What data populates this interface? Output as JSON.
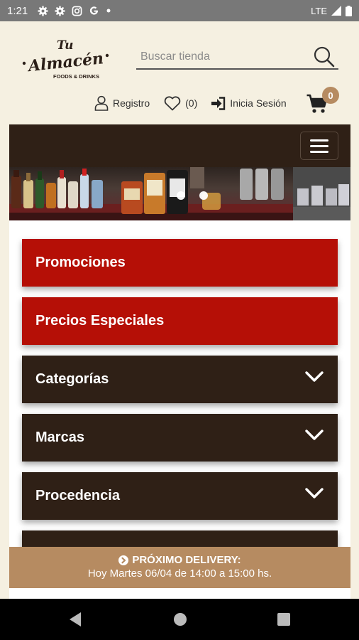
{
  "status_bar": {
    "time": "1:21",
    "network": "LTE",
    "icons": [
      "gear-icon",
      "gear-icon",
      "instagram-icon",
      "google-icon",
      "dot-icon",
      "wifi-icon",
      "signal-icon",
      "battery-icon"
    ]
  },
  "header": {
    "logo": {
      "line1": "Tu",
      "line2": "Almacén",
      "tagline": "FOODS & DRINKS"
    },
    "search": {
      "placeholder": "Buscar tienda",
      "value": ""
    },
    "register_label": "Registro",
    "wishlist_count": "(0)",
    "login_label": "Inicia Sesión",
    "cart_count": "0"
  },
  "menu": {
    "items": [
      {
        "label": "Promociones",
        "style": "red",
        "expandable": false
      },
      {
        "label": "Precios Especiales",
        "style": "red",
        "expandable": false
      },
      {
        "label": "Categorías",
        "style": "brown",
        "expandable": true
      },
      {
        "label": "Marcas",
        "style": "brown",
        "expandable": true
      },
      {
        "label": "Procedencia",
        "style": "brown",
        "expandable": true
      }
    ]
  },
  "delivery": {
    "title": "PRÓXIMO DELIVERY:",
    "detail": "Hoy Martes 06/04 de 14:00 a 15:00 hs."
  },
  "colors": {
    "background": "#f5f0e1",
    "red": "#b50f06",
    "brown": "#2f2016",
    "accent": "#b68b61"
  }
}
